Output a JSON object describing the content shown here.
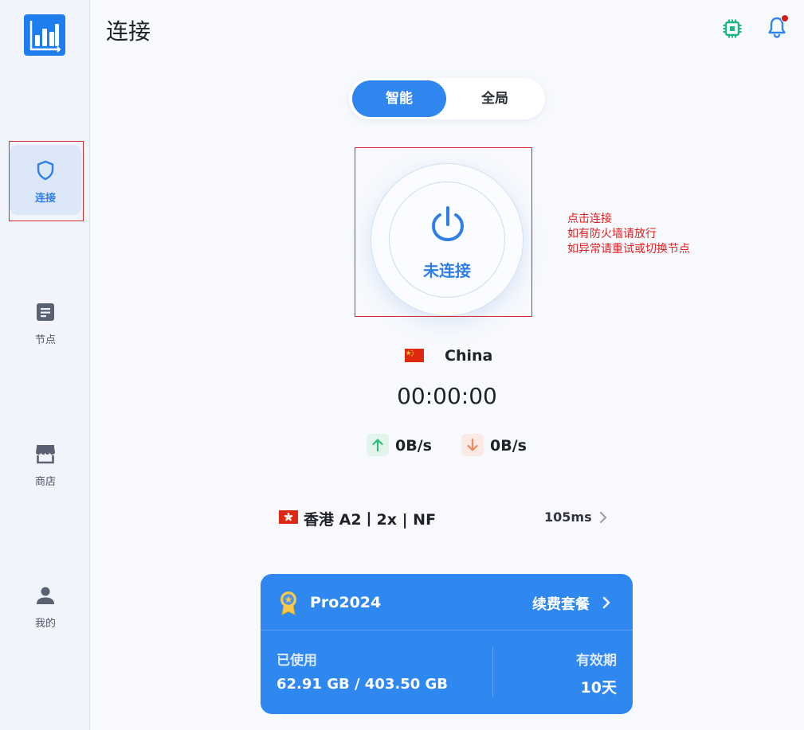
{
  "sidebar": {
    "logo": "bar-chart-logo",
    "items": [
      {
        "label": "连接",
        "icon": "shield-icon",
        "active": true
      },
      {
        "label": "节点",
        "icon": "document-icon",
        "active": false
      },
      {
        "label": "商店",
        "icon": "store-icon",
        "active": false
      },
      {
        "label": "我的",
        "icon": "user-icon",
        "active": false
      }
    ]
  },
  "header": {
    "title": "连接",
    "icons": [
      "chip-icon",
      "bell-icon"
    ]
  },
  "mode": {
    "options": [
      "智能",
      "全局"
    ],
    "selected": "智能"
  },
  "power": {
    "status": "未连接",
    "hint": [
      "点击连接",
      "如有防火墙请放行",
      "如异常请重试或切换节点"
    ]
  },
  "location": {
    "country": "China"
  },
  "timer": "00:00:00",
  "speed": {
    "upload": "0B/s",
    "download": "0B/s"
  },
  "node": {
    "name": "香港 A2丨2x | NF",
    "latency": "105ms"
  },
  "plan": {
    "name": "Pro2024",
    "renew_label": "续费套餐",
    "used_label": "已使用",
    "used_value": "62.91 GB / 403.50 GB",
    "expire_label": "有效期",
    "expire_value": "10天"
  },
  "colors": {
    "accent": "#2f86ef",
    "hint_red": "#e02020",
    "upload_green": "#2dbd7d",
    "download_orange": "#f08a5d"
  }
}
